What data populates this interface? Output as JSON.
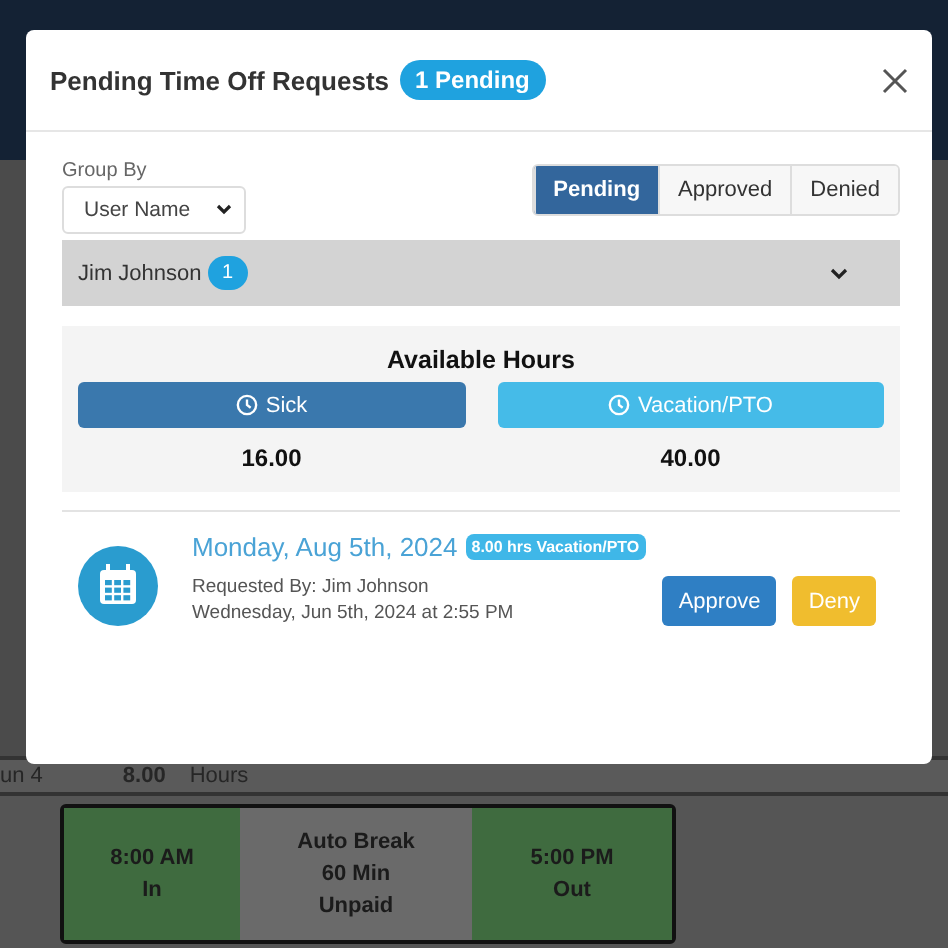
{
  "background": {
    "day": {
      "date": "un 4",
      "hours": "8.00",
      "unit": "Hours"
    },
    "punches": [
      {
        "kind": "in",
        "lines": [
          "8:00 AM",
          "In"
        ]
      },
      {
        "kind": "break",
        "lines": [
          "Auto Break",
          "60 Min",
          "Unpaid"
        ]
      },
      {
        "kind": "out",
        "lines": [
          "5:00 PM",
          "Out"
        ]
      }
    ]
  },
  "dialog": {
    "title": "Pending Time Off Requests",
    "badge": "1 Pending",
    "group_by": {
      "label": "Group By",
      "value": "User Name"
    },
    "tabs": [
      {
        "label": "Pending",
        "selected": true
      },
      {
        "label": "Approved",
        "selected": false
      },
      {
        "label": "Denied",
        "selected": false
      }
    ],
    "group": {
      "name": "Jim Johnson",
      "count": "1"
    },
    "available_hours": {
      "title": "Available Hours",
      "types": [
        {
          "label": "Sick",
          "hours": "16.00",
          "color": "#3a78ad"
        },
        {
          "label": "Vacation/PTO",
          "hours": "40.00",
          "color": "#45bbe8"
        }
      ]
    },
    "requests": [
      {
        "date": "Monday, Aug 5th, 2024",
        "tag": "8.00 hrs Vacation/PTO",
        "requested_by": "Requested By: Jim Johnson",
        "submitted": "Wednesday, Jun 5th, 2024 at 2:55 PM",
        "actions": [
          {
            "kind": "approve",
            "label": "Approve"
          },
          {
            "kind": "deny",
            "label": "Deny"
          }
        ]
      }
    ]
  }
}
